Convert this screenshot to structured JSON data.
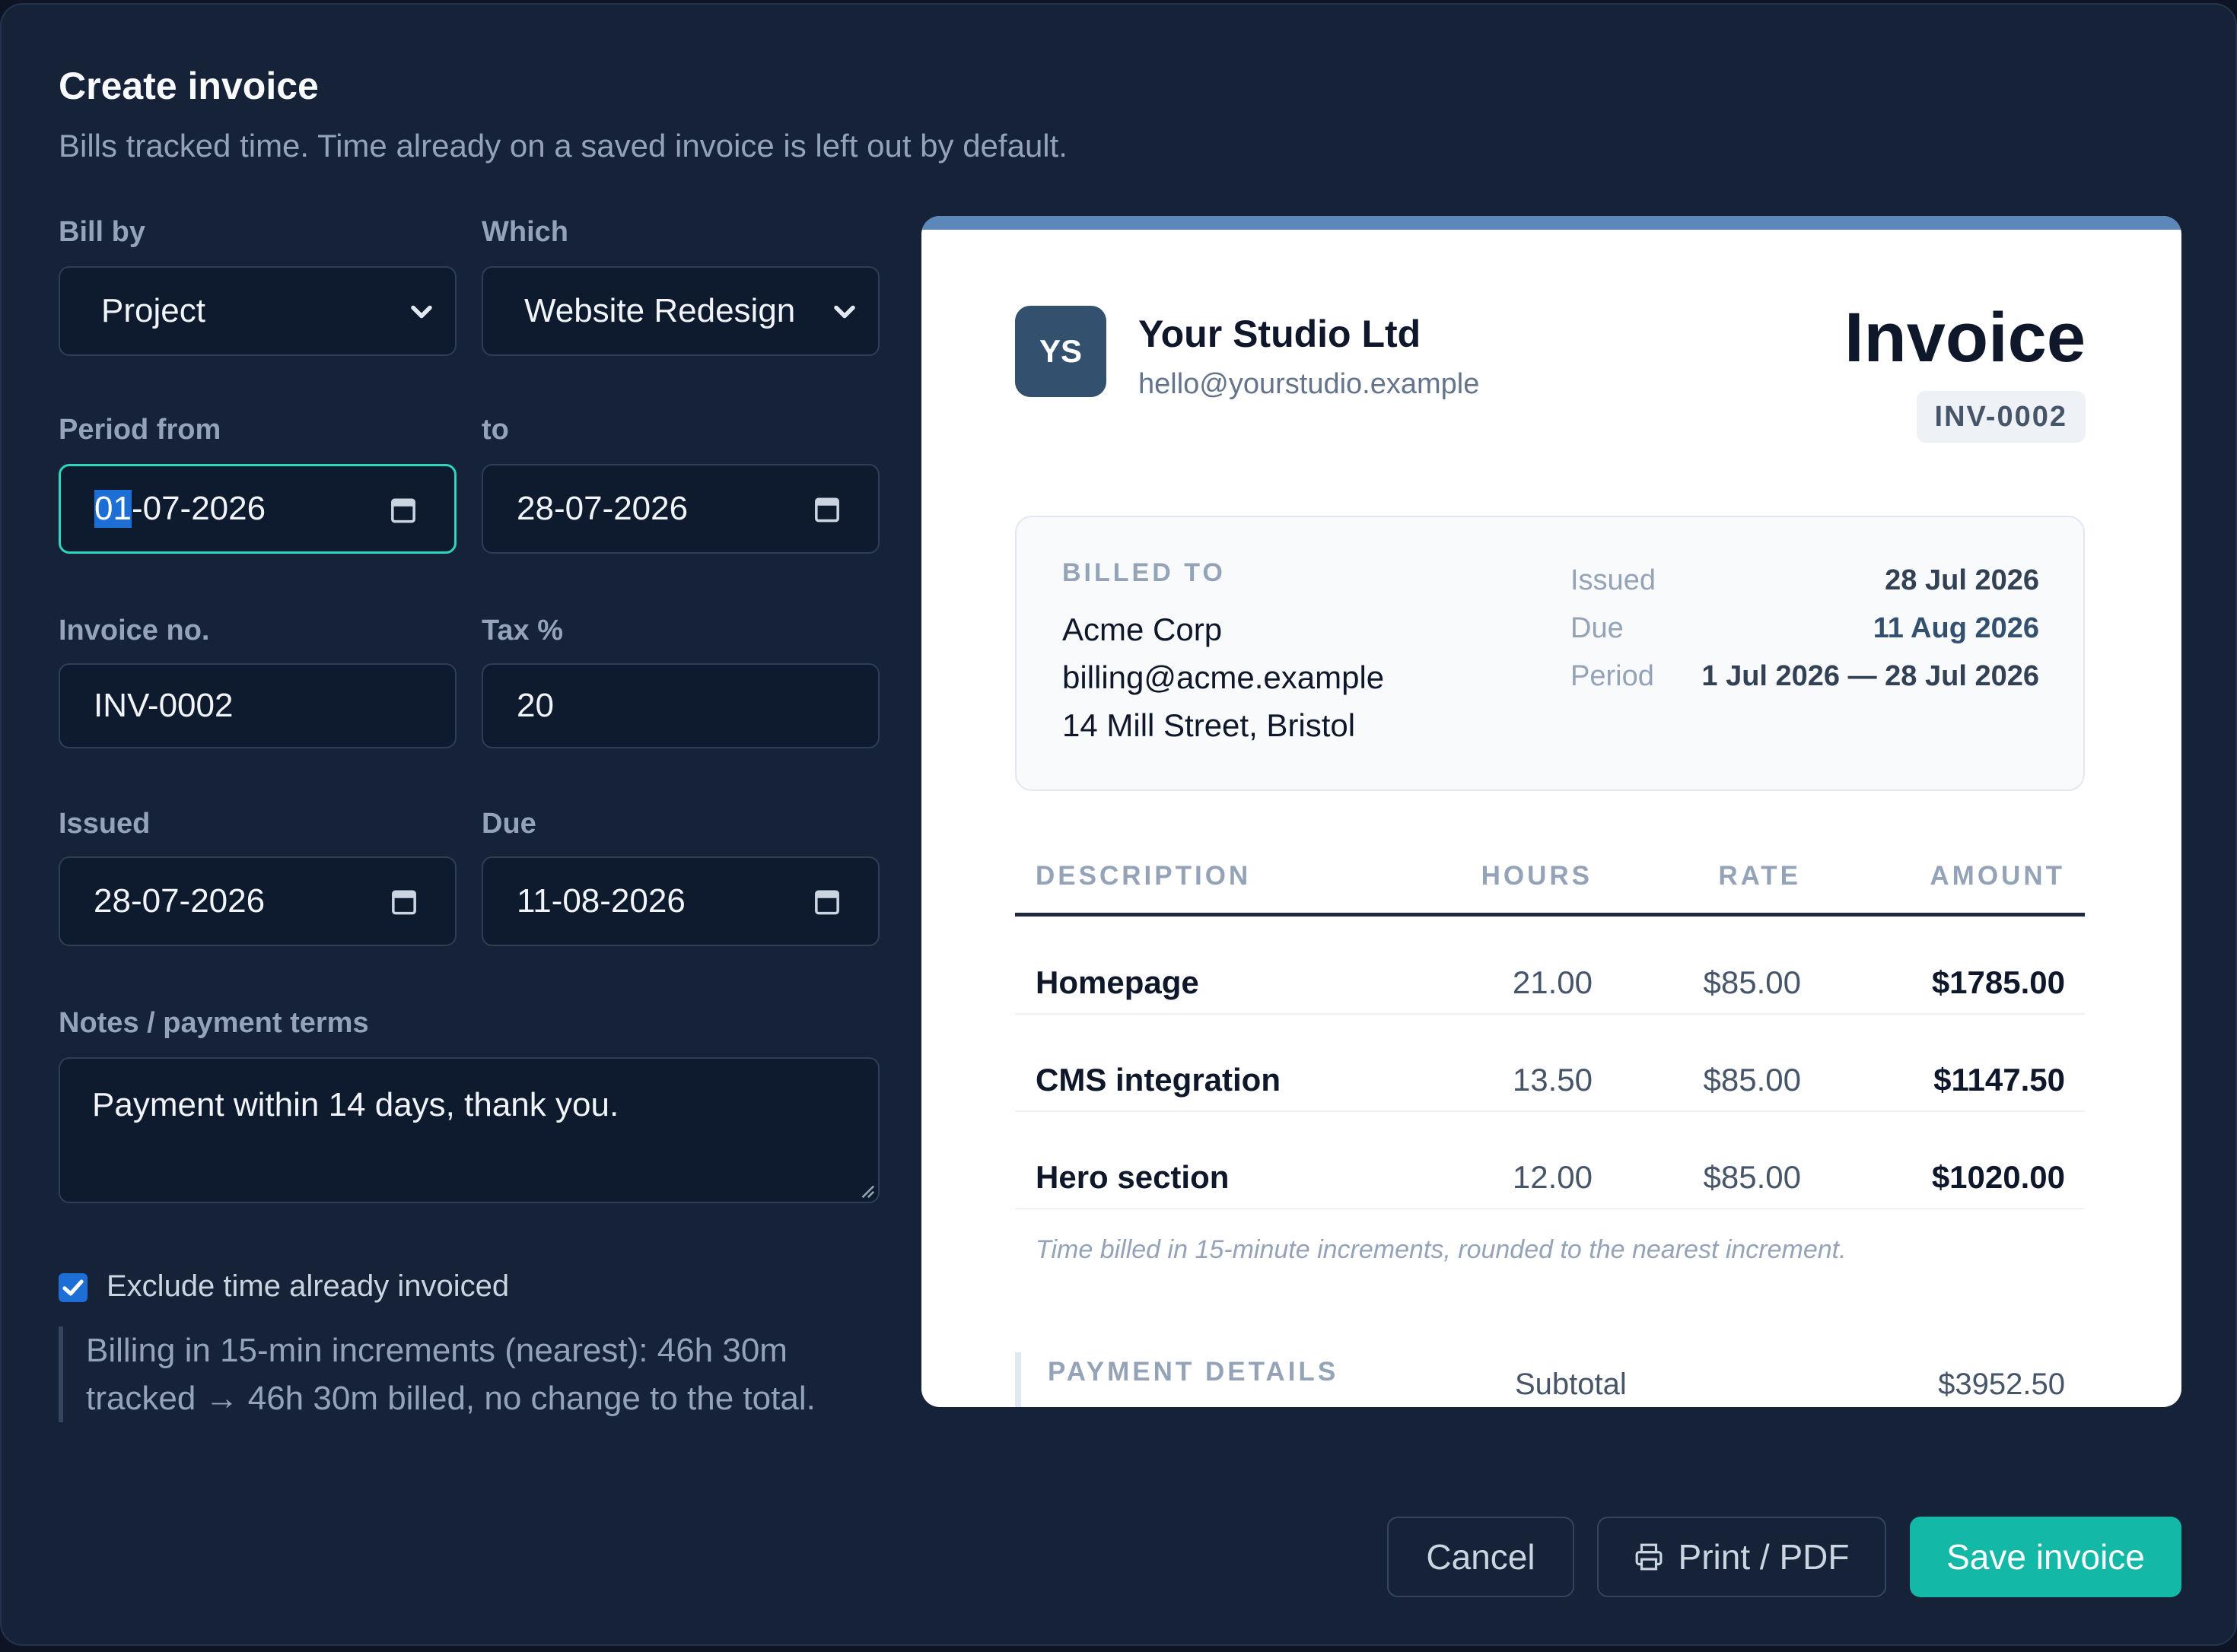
{
  "dialog": {
    "title": "Create invoice",
    "subtitle": "Bills tracked time. Time already on a saved invoice is left out by default."
  },
  "form": {
    "bill_by": {
      "label": "Bill by",
      "value": "Project"
    },
    "which": {
      "label": "Which",
      "value": "Website Redesign"
    },
    "period_from": {
      "label": "Period from",
      "day": "01",
      "rest": "-07-2026"
    },
    "period_to": {
      "label": "to",
      "value": "28-07-2026"
    },
    "invoice_no": {
      "label": "Invoice no.",
      "value": "INV-0002"
    },
    "tax": {
      "label": "Tax %",
      "value": "20"
    },
    "issued": {
      "label": "Issued",
      "value": "28-07-2026"
    },
    "due": {
      "label": "Due",
      "value": "11-08-2026"
    },
    "notes": {
      "label": "Notes / payment terms",
      "value": "Payment within 14 days, thank you."
    },
    "exclude_invoiced": {
      "label": "Exclude time already invoiced",
      "checked": true
    },
    "rounding_note": "Billing in 15-min increments (nearest): 46h 30m tracked → 46h 30m billed, no change to the total."
  },
  "invoice": {
    "logo_initials": "YS",
    "studio_name": "Your Studio Ltd",
    "studio_email": "hello@yourstudio.example",
    "heading": "Invoice",
    "number": "INV-0002",
    "billed_to_label": "BILLED TO",
    "client": [
      "Acme Corp",
      "billing@acme.example",
      "14 Mill Street, Bristol"
    ],
    "meta": [
      {
        "key": "Issued",
        "value": "28 Jul 2026"
      },
      {
        "key": "Due",
        "value": "11 Aug 2026"
      },
      {
        "key": "Period",
        "value": "1 Jul 2026 — 28 Jul 2026"
      }
    ],
    "columns": [
      "DESCRIPTION",
      "HOURS",
      "RATE",
      "AMOUNT"
    ],
    "rows": [
      {
        "desc": "Homepage",
        "hours": "21.00",
        "rate": "$85.00",
        "amount": "$1785.00"
      },
      {
        "desc": "CMS integration",
        "hours": "13.50",
        "rate": "$85.00",
        "amount": "$1147.50"
      },
      {
        "desc": "Hero section",
        "hours": "12.00",
        "rate": "$85.00",
        "amount": "$1020.00"
      }
    ],
    "footnote": "Time billed in 15-minute increments, rounded to the nearest increment.",
    "payment_details_label": "PAYMENT DETAILS",
    "subtotal_label": "Subtotal",
    "subtotal_value": "$3952.50"
  },
  "actions": {
    "cancel": "Cancel",
    "print": "Print / PDF",
    "save": "Save invoice"
  },
  "colors": {
    "accent": "#14b8a6",
    "modal_bg": "#162238",
    "field_bg": "#0e1a2d",
    "invoice_top_bar": "#5b88b8"
  }
}
